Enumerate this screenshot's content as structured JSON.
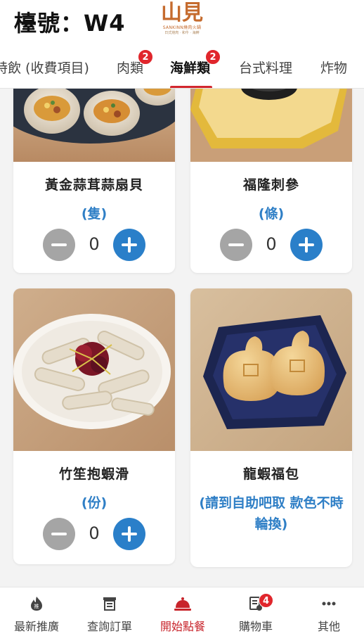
{
  "header": {
    "table_label": "檯號：W4"
  },
  "brand": {
    "mark": "山見",
    "sub": "SANKINN燒肉火鍋",
    "sub2": "日式燒肉 · 和牛 · 海鮮"
  },
  "tabs": [
    {
      "label": "特飲 (收費項目)",
      "badge": null
    },
    {
      "label": "肉類",
      "badge": "2"
    },
    {
      "label": "海鮮類",
      "badge": "2",
      "active": true
    },
    {
      "label": "台式料理",
      "badge": null
    },
    {
      "label": "炸物",
      "badge": null
    }
  ],
  "items": [
    {
      "name": "黃金蒜茸蒜扇貝",
      "unit": "(隻)",
      "qty": "0"
    },
    {
      "name": "福隆刺參",
      "unit": "(條)",
      "qty": "0"
    },
    {
      "name": "竹笙抱蝦滑",
      "unit": "(份)",
      "qty": "0"
    },
    {
      "name": "龍蝦福包",
      "unit": "(請到自助吧取 款色不時輪換)",
      "qty": null
    }
  ],
  "bottom_nav": [
    {
      "label": "最新推廣",
      "icon": "fire-icon"
    },
    {
      "label": "查詢訂單",
      "icon": "receipt-icon"
    },
    {
      "label": "開始點餐",
      "icon": "cloche-icon",
      "active": true
    },
    {
      "label": "購物車",
      "icon": "cart-list-icon",
      "badge": "4"
    },
    {
      "label": "其他",
      "icon": "more-dots-icon"
    }
  ],
  "colors": {
    "accent_red": "#d2262e",
    "accent_blue": "#2a7fc9",
    "badge_red": "#e0262c",
    "minus_gray": "#a5a5a5"
  }
}
